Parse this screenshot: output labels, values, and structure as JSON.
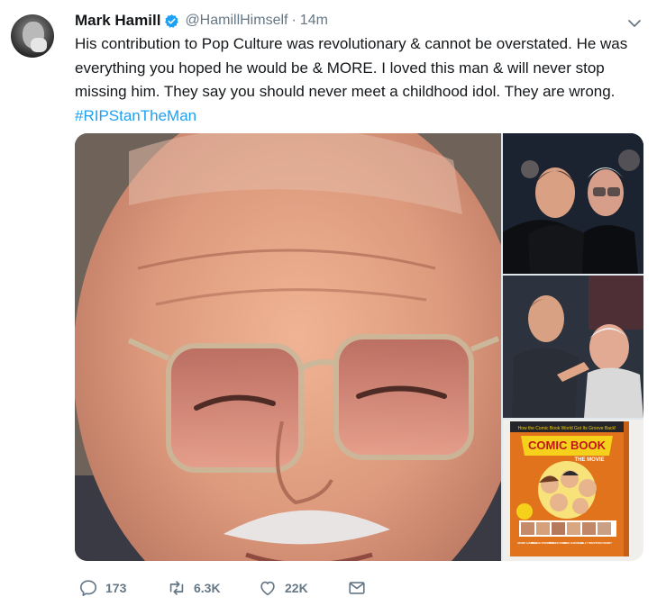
{
  "tweet": {
    "author_name": "Mark Hamill",
    "handle": "@HamillHimself",
    "separator": "·",
    "time": "14m",
    "text_lines": [
      "His contribution to Pop Culture was revolutionary & cannot be overstated. He was",
      "everything you hoped he would be & MORE. I loved this man & will never stop",
      "missing him. They say you should never meet a childhood idol. They are wrong."
    ],
    "hashtag": "#RIPStanTheMan",
    "comic_book": {
      "tagline": "How the Comic Book World Got Its Groove Back!",
      "title": "COMIC BOOK",
      "subtitle": "THE MOVIE",
      "credits": [
        "MARK HAMILL",
        "DONNA D'ERRICO",
        "ROGER ROSE",
        "JESS HARNELL",
        "BILLY WEST",
        "TOM KENNY"
      ]
    },
    "stats": {
      "replies": "173",
      "retweets": "6.3K",
      "likes": "22K"
    },
    "colors": {
      "accent": "#1da1f2",
      "muted": "#657786",
      "text": "#14171a",
      "verified": "#1da1f2"
    }
  }
}
